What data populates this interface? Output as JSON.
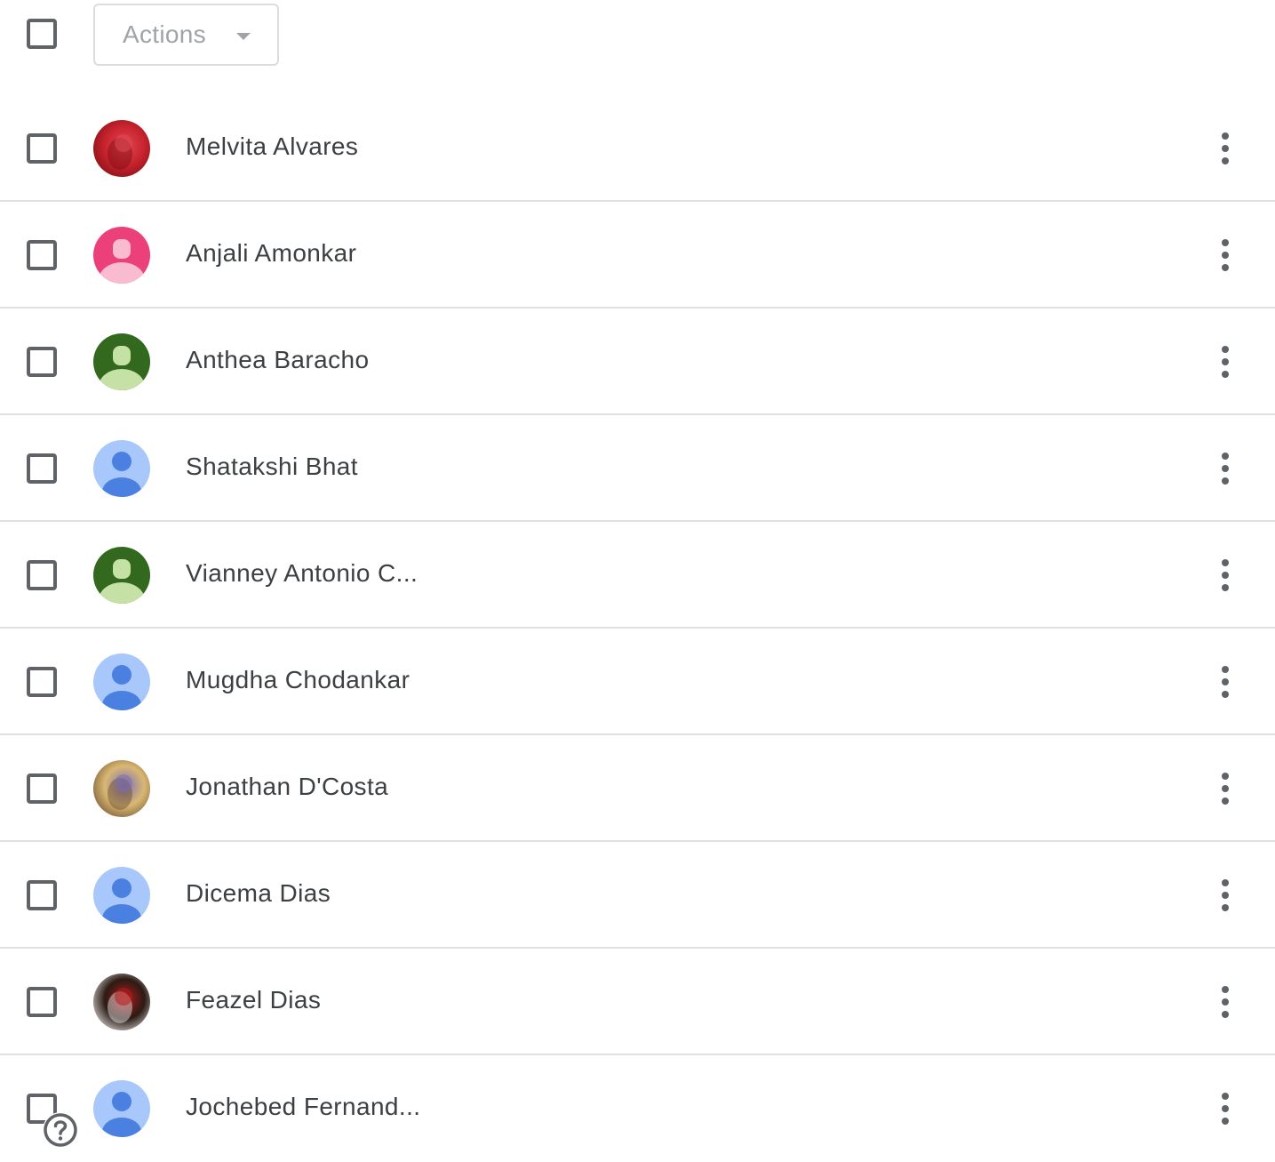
{
  "toolbar": {
    "actions_label": "Actions",
    "select_all_icon": "checkbox-outline-icon",
    "caret_icon": "arrow-drop-down-icon"
  },
  "contacts": [
    {
      "name": "Melvita Alvares",
      "avatar": "photo",
      "photo_colors": [
        "#7a0d12",
        "#c8232e",
        "#e04854"
      ]
    },
    {
      "name": "Anjali Amonkar",
      "avatar": "generic",
      "bg": "#ec407a",
      "fg": "#f8bbd0"
    },
    {
      "name": "Anthea Baracho",
      "avatar": "generic",
      "bg": "#33691e",
      "fg": "#c5e1a5"
    },
    {
      "name": "Shatakshi Bhat",
      "avatar": "default",
      "bg": "#a8c7fa",
      "fg": "#4a80e0"
    },
    {
      "name": "Vianney Antonio C...",
      "avatar": "generic",
      "bg": "#33691e",
      "fg": "#c5e1a5"
    },
    {
      "name": "Mugdha Chodankar",
      "avatar": "default",
      "bg": "#a8c7fa",
      "fg": "#4a80e0"
    },
    {
      "name": "Jonathan D'Costa",
      "avatar": "photo",
      "photo_colors": [
        "#6b4c2e",
        "#d9b873",
        "#7b6fb3"
      ]
    },
    {
      "name": "Dicema Dias",
      "avatar": "default",
      "bg": "#a8c7fa",
      "fg": "#4a80e0"
    },
    {
      "name": "Feazel Dias",
      "avatar": "photo",
      "photo_colors": [
        "#f2f2f2",
        "#2b1b14",
        "#b31c1c"
      ]
    },
    {
      "name": "Jochebed Fernand...",
      "avatar": "default",
      "bg": "#a8c7fa",
      "fg": "#4a80e0"
    }
  ],
  "row_icons": {
    "checkbox": "checkbox-outline-icon",
    "menu": "more-vert-icon"
  },
  "help": {
    "icon": "help-circle-icon"
  },
  "colors": {
    "text": "#3c4043",
    "muted": "#a0a3a7",
    "divider": "#e0e0e0",
    "icon": "#5f6368"
  }
}
